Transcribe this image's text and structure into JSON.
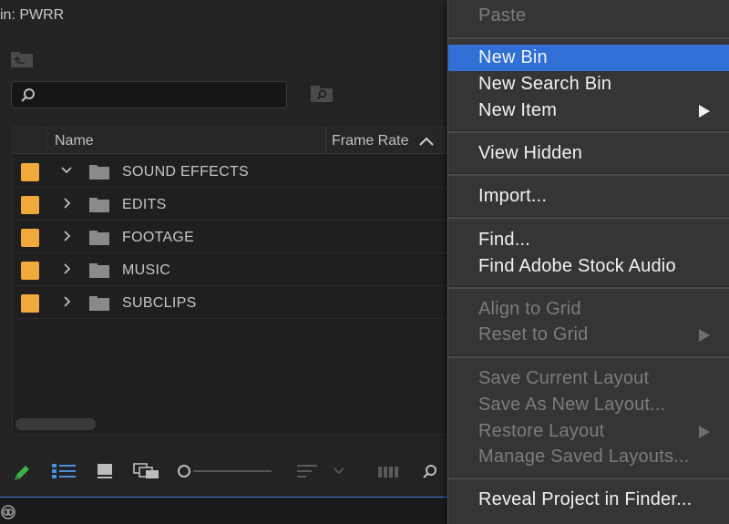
{
  "panel": {
    "title": "in: PWRR",
    "search": {
      "placeholder": "",
      "value": ""
    },
    "columns": {
      "name": "Name",
      "frame_rate": "Frame Rate"
    },
    "rows": [
      {
        "label": "SOUND EFFECTS",
        "expanded": true,
        "color": "#f2a93b"
      },
      {
        "label": "EDITS",
        "expanded": false,
        "color": "#f2a93b"
      },
      {
        "label": "FOOTAGE",
        "expanded": false,
        "color": "#f2a93b"
      },
      {
        "label": "MUSIC",
        "expanded": false,
        "color": "#f2a93b"
      },
      {
        "label": "SUBCLIPS",
        "expanded": false,
        "color": "#f2a93b"
      }
    ],
    "bottom_icons": [
      "pencil-icon",
      "list-view-icon",
      "icon-view-icon",
      "freeform-view-icon",
      "zoom-slider",
      "sort-icon",
      "chevron-down-icon",
      "automate-to-sequence-icon",
      "find-icon"
    ]
  },
  "menu": {
    "items": [
      {
        "label": "Paste",
        "disabled": true
      },
      {
        "label": "New Bin",
        "highlighted": true
      },
      {
        "label": "New Search Bin"
      },
      {
        "label": "New Item",
        "submenu": true
      },
      {
        "label": "View Hidden"
      },
      {
        "label": "Import..."
      },
      {
        "label": "Find..."
      },
      {
        "label": "Find Adobe Stock Audio"
      },
      {
        "label": "Align to Grid",
        "disabled": true
      },
      {
        "label": "Reset to Grid",
        "disabled": true,
        "submenu": true
      },
      {
        "label": "Save Current Layout",
        "disabled": true
      },
      {
        "label": "Save As New Layout...",
        "disabled": true
      },
      {
        "label": "Restore Layout",
        "disabled": true,
        "submenu": true
      },
      {
        "label": "Manage Saved Layouts...",
        "disabled": true
      },
      {
        "label": "Reveal Project in Finder..."
      }
    ]
  },
  "colors": {
    "accent": "#2f6fd6",
    "label_orange": "#f2a93b",
    "pencil_green": "#3fb34a"
  }
}
